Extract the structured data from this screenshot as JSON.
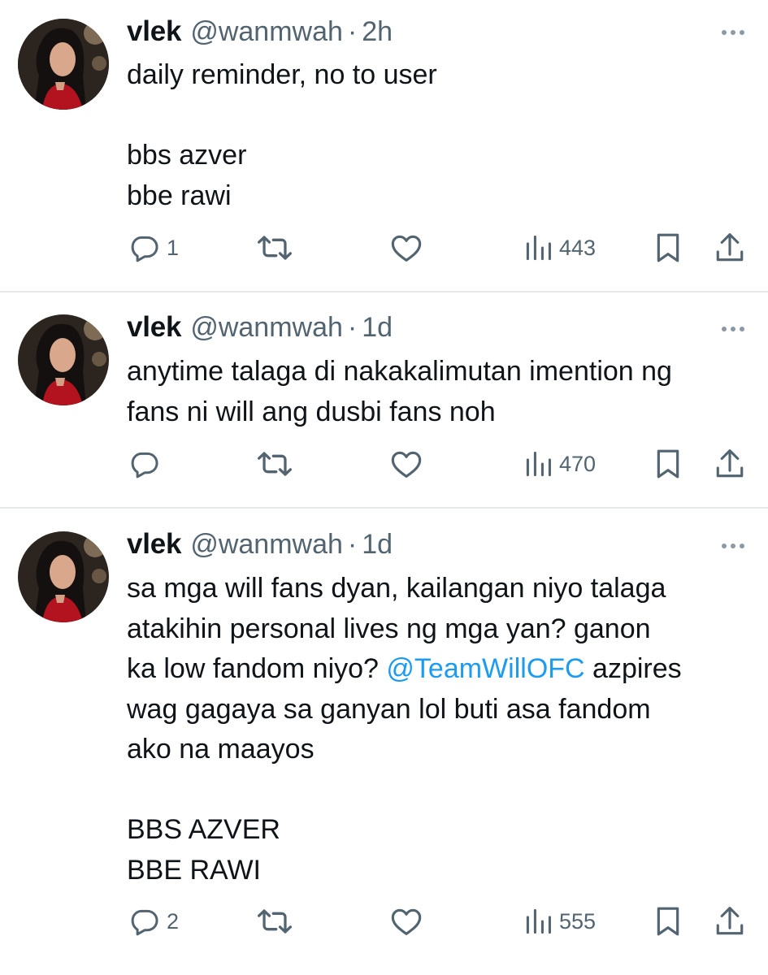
{
  "colors": {
    "text": "#0f1419",
    "secondary": "#536471",
    "mention": "#1d9bf0",
    "divider": "#e6e9ec"
  },
  "tweets": [
    {
      "name": "vlek",
      "handle": "@wanmwah",
      "separator": "·",
      "time": "2h",
      "lines": [
        "daily reminder, no to user",
        "",
        "bbs azver",
        "bbe rawi"
      ],
      "replies": "1",
      "views": "443"
    },
    {
      "name": "vlek",
      "handle": "@wanmwah",
      "separator": "·",
      "time": "1d",
      "lines": [
        "anytime talaga di nakakalimutan imention ng",
        "fans ni will ang dusbi fans noh"
      ],
      "replies": "",
      "views": "470"
    },
    {
      "name": "vlek",
      "handle": "@wanmwah",
      "separator": "·",
      "time": "1d",
      "lines": [
        "sa mga will fans dyan, kailangan niyo talaga",
        "atakihin personal lives ng mga yan? ganon"
      ],
      "line3_before": "ka low fandom niyo? ",
      "line3_mention": "@TeamWillOFC",
      "line3_after": " azpires",
      "lines_after": [
        "wag gagaya sa ganyan lol buti asa fandom",
        "ako na maayos",
        "",
        "BBS AZVER",
        "BBE RAWI"
      ],
      "replies": "2",
      "views": "555"
    }
  ],
  "icons": [
    "more-icon",
    "reply-icon",
    "retweet-icon",
    "like-icon",
    "views-icon",
    "bookmark-icon",
    "share-icon"
  ]
}
